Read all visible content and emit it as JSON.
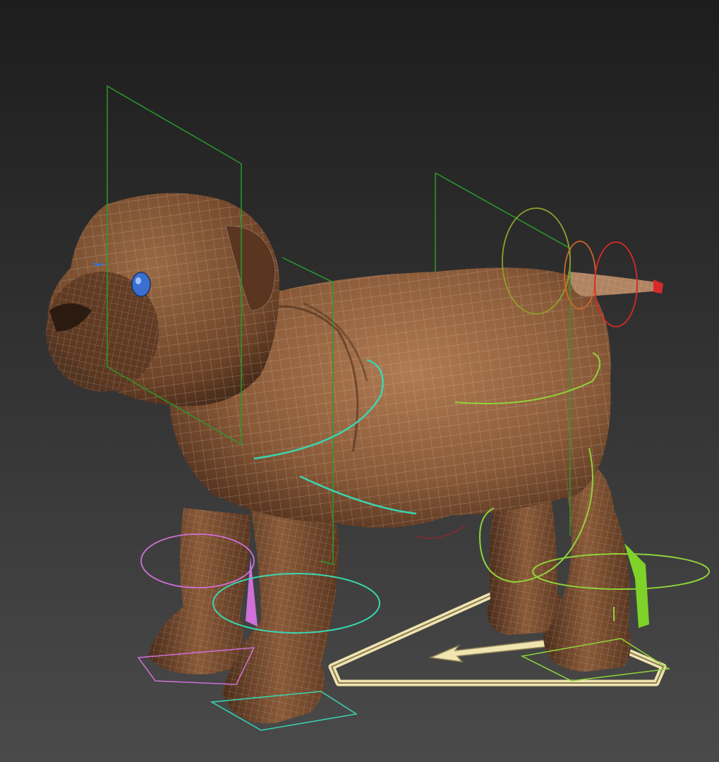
{
  "viewport": {
    "background_top": "#1d1d1d",
    "background_bottom": "#4a4a4a"
  },
  "model": {
    "subject": "bulldog-mesh",
    "skin_color": "#8a5a38",
    "skin_shadow": "#4a2c1a",
    "skin_highlight": "#b07a52",
    "wire_color": "#d8d0c8",
    "eye_color": "#3a6fd0"
  },
  "rig_colors": {
    "spine_plane": "#2a9a2a",
    "neck_circles": "#3ad6b0",
    "front_leg_left": "#d070d8",
    "front_leg_right": "#3ad6b0",
    "hind_leg": "#8fd43a",
    "tail_green": "#8fa02a",
    "tail_orange": "#d0662a",
    "tail_red": "#d82a2a",
    "root_controller": "#f0e4b0"
  }
}
